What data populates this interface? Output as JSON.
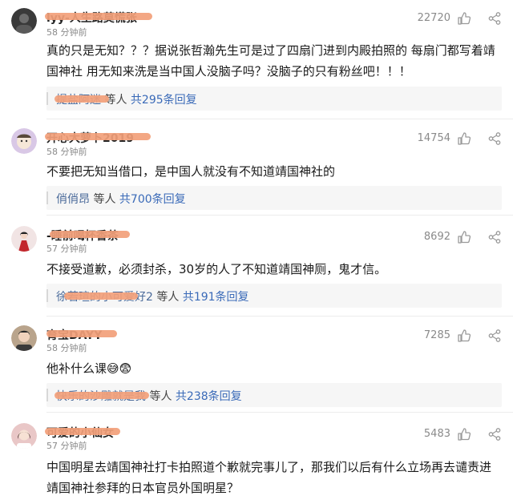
{
  "comments": [
    {
      "username": "lyy-人生路莫慌张",
      "time": "58 分钟前",
      "likes": "22720",
      "text": "真的只是无知？？？据说张哲瀚先生可是过了四扇门进到内殿拍照的 每扇门都写着靖国神社 用无知来洗是当中国人没脑子吗？没脑子的只有粉丝吧！！！",
      "reply_user": "提盐阿迷",
      "reply_mid": " 等人 ",
      "reply_count": "共295条回复",
      "avatar_icon": "dark-avatar-icon",
      "avatar_color": "#3a3a3a"
    },
    {
      "username": "开心大萝卜2019",
      "time": "58 分钟前",
      "likes": "14754",
      "text": "不要把无知当借口，是中国人就没有不知道靖国神社的",
      "reply_user": "俏俏昂",
      "reply_mid": " 等人 ",
      "reply_count": "共700条回复",
      "avatar_icon": "cartoon-avatar-icon",
      "avatar_color": "#d9c8e6"
    },
    {
      "username": "-睡前喝杯香茶",
      "time": "57 分钟前",
      "likes": "8692",
      "text": "不接受道歉，必须封杀，30岁的人了不知道靖国神厕，鬼才信。",
      "reply_user": "徐若瑄的小可爱好2",
      "reply_mid": " 等人 ",
      "reply_count": "共191条回复",
      "avatar_icon": "red-dress-avatar-icon",
      "avatar_color": "#c2272d"
    },
    {
      "username": "育宝DAYY",
      "time": "58 分钟前",
      "likes": "7285",
      "text": "他补什么课😅😨",
      "reply_user": "快乐的沙雕就是我",
      "reply_mid": " 等人 ",
      "reply_count": "共238条回复",
      "avatar_icon": "portrait-avatar-icon",
      "avatar_color": "#b9a48c"
    },
    {
      "username": "可爱的小仙女",
      "time": "57 分钟前",
      "likes": "5483",
      "text": "中国明星去靖国神社打卡拍照道个歉就完事儿了，那我们以后有什么立场再去谴责进靖国神社参拜的日本官员外国明星？",
      "reply_user": "",
      "reply_mid": "",
      "reply_count": "",
      "avatar_icon": "girl-avatar-icon",
      "avatar_color": "#e9c7c7"
    }
  ],
  "colors": {
    "accent": "#3a6ab8",
    "redaction": "#f2a07a",
    "muted": "#8a8a8a"
  }
}
